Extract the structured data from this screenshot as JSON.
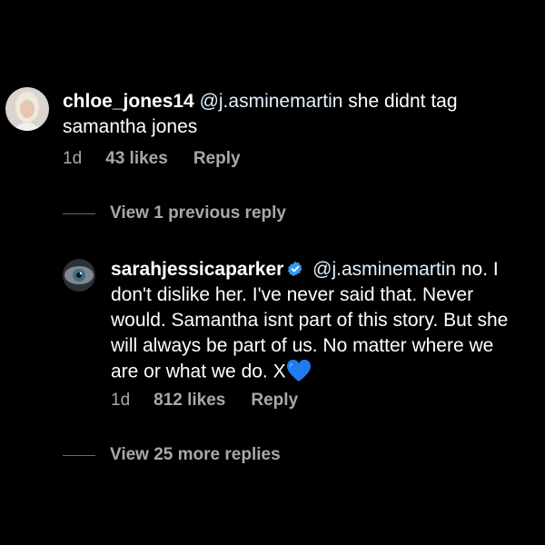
{
  "comments": [
    {
      "username": "chloe_jones14",
      "mention": "@j.asminemartin",
      "text": " she didnt tag samantha jones",
      "time": "1d",
      "likes": "43 likes",
      "reply": "Reply"
    },
    {
      "username": "sarahjessicaparker",
      "mention": "@j.asminemartin",
      "text": "no. I don't dislike her.  I've never said that. Never would. Samantha isnt part of this story. But she will always be part of us. No matter where we are or what we do. X",
      "emoji_icon": "blue-heart-icon",
      "time": "1d",
      "likes": "812 likes",
      "reply": "Reply"
    }
  ],
  "view_previous": "View 1 previous reply",
  "view_more": "View 25 more replies",
  "colors": {
    "background": "#000000",
    "text": "#ffffff",
    "meta": "#a8a8a8",
    "verified": "#3897f0",
    "heart": "#1e7bf0"
  }
}
